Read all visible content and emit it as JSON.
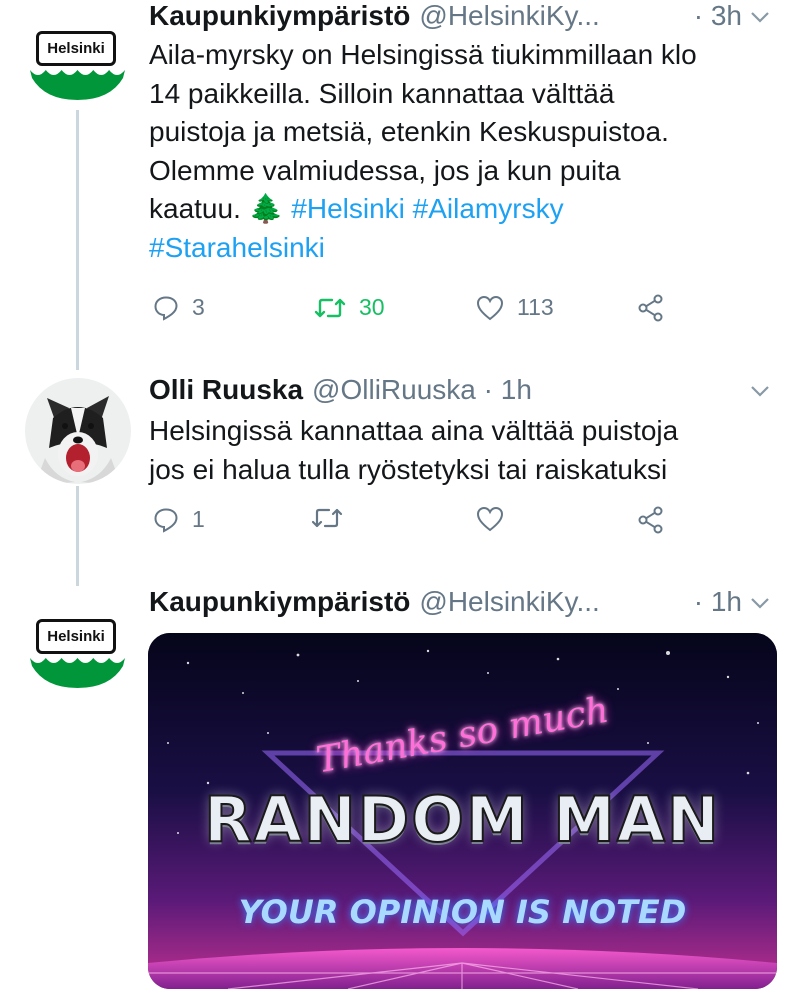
{
  "tweets": [
    {
      "name": "Kaupunkiympäristö",
      "handle": "@HelsinkiKy...",
      "time": "· 3h",
      "avatar_label": "Helsinki",
      "text_lines": [
        "Aila-myrsky on Helsingissä tiukimmillaan klo",
        "14 paikkeilla. Silloin kannattaa välttää",
        "puistoja ja metsiä, etenkin Keskuspuistoa.",
        "Olemme valmiudessa, jos ja kun puita",
        "kaatuu. 🌲"
      ],
      "hashtags": [
        "#Helsinki",
        "#Ailamyrsky",
        "#Starahelsinki"
      ],
      "replies": "3",
      "retweets": "30",
      "likes": "113"
    },
    {
      "name": "Olli Ruuska",
      "handle": "@OlliRuuska",
      "time": "· 1h",
      "text_lines": [
        "Helsingissä kannattaa aina välttää puistoja",
        "jos ei halua tulla ryöstetyksi tai raiskatuksi"
      ],
      "replies": "1",
      "retweets": "",
      "likes": ""
    },
    {
      "name": "Kaupunkiympäristö",
      "handle": "@HelsinkiKy...",
      "time": "· 1h",
      "avatar_label": "Helsinki",
      "media": {
        "line1": "Thanks so much",
        "line2": "RANDOM MAN",
        "line3": "YOUR OPINION IS NOTED"
      }
    }
  ],
  "icons": {
    "reply": "reply-icon",
    "retweet": "retweet-icon",
    "like": "heart-icon",
    "share": "share-icon",
    "caret": "chevron-down-icon"
  },
  "colors": {
    "link": "#1da1f2",
    "secondary_text": "#657786",
    "retweet_active": "#17bf63",
    "helsinki_green": "#009639",
    "thread_line": "#ccd6dd"
  }
}
